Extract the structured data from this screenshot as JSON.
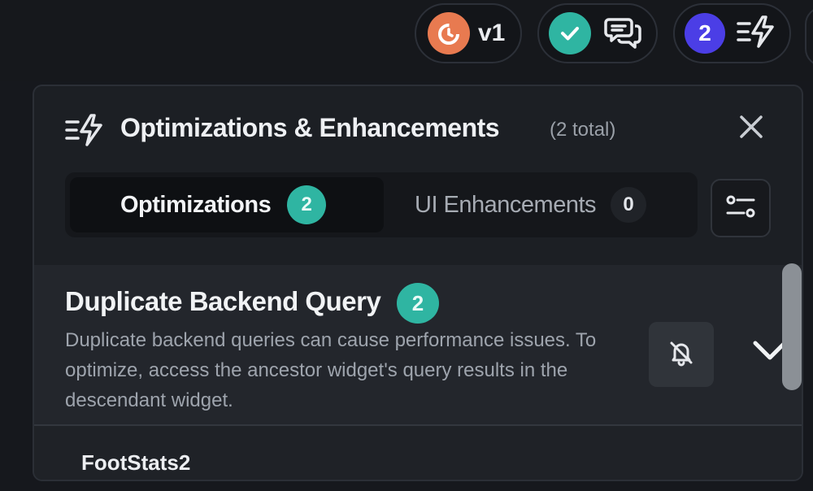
{
  "topbar": {
    "version_label": "v1",
    "optimizations_count": "2",
    "icons": {
      "version": "timer-refresh-icon",
      "check": "check-circle-icon",
      "chat": "chat-bubbles-icon",
      "optimizations": "lightning-lines-icon"
    },
    "colors": {
      "version": "#e87a50",
      "check": "#2fb5a2",
      "count": "#4b3ee6"
    }
  },
  "panel": {
    "title": "Optimizations & Enhancements",
    "total": "(2 total)",
    "tabs": [
      {
        "label": "Optimizations",
        "count": "2",
        "active": true
      },
      {
        "label": "UI Enhancements",
        "count": "0",
        "active": false
      }
    ],
    "filter_icon": "sliders-icon",
    "close_icon": "close-icon",
    "items": [
      {
        "title": "Duplicate Backend Query",
        "count": "2",
        "description": "Duplicate backend queries can cause performance issues. To optimize, access the ancestor widget's query results in the descendant widget.",
        "mute_icon": "bell-off-icon",
        "expand_icon": "chevron-down-icon"
      }
    ],
    "sub_item": "FootStats2",
    "accent": "#2fb5a2"
  }
}
